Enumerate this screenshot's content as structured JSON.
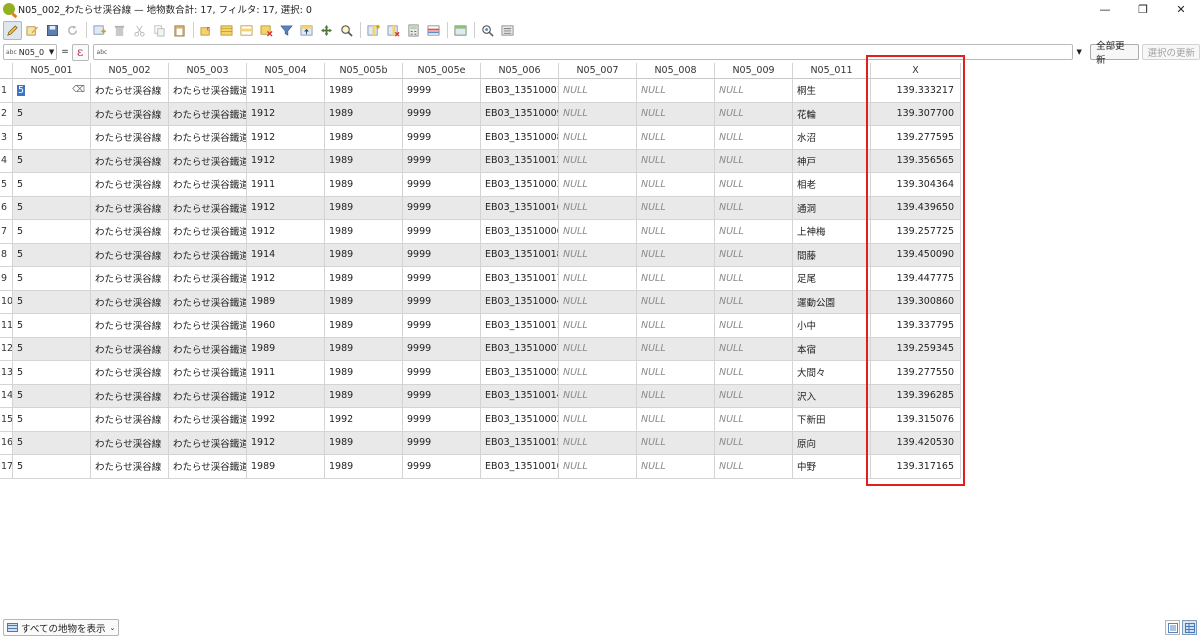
{
  "window": {
    "title": "N05_002_わたらせ渓谷線 — 地物数合計: 17, フィルタ: 17, 選択: 0",
    "minimize": "—",
    "restore": "❐",
    "close": "✕"
  },
  "toolbar": {
    "icons": [
      "edit-pencil-icon",
      "multi-edit-icon",
      "save-icon",
      "reload-icon",
      "add-feature-icon",
      "delete-icon",
      "cut-icon",
      "copy-icon",
      "paste-icon",
      "select-expression-icon",
      "select-all-icon",
      "invert-selection-icon",
      "deselect-icon",
      "filter-icon",
      "move-top-icon",
      "pan-to-icon",
      "zoom-to-icon",
      "new-field-icon",
      "delete-field-icon",
      "field-calculator-icon",
      "conditional-format-icon",
      "dock-icon",
      "actions-icon",
      "settings-icon"
    ]
  },
  "filter": {
    "field_type": "abc",
    "field_name": "N05_0",
    "equals": "=",
    "epsilon": "ε",
    "expression_type": "abc",
    "update_all": "全部更新",
    "update_selected": "選択の更新"
  },
  "table": {
    "columns": [
      "N05_001",
      "N05_002",
      "N05_003",
      "N05_004",
      "N05_005b",
      "N05_005e",
      "N05_006",
      "N05_007",
      "N05_008",
      "N05_009",
      "N05_011",
      "X"
    ],
    "rows": [
      {
        "n": "1",
        "c": [
          "5",
          "わたらせ渓谷線",
          "わたらせ渓谷鐵道",
          "1911",
          "1989",
          "9999",
          "EB03_13510001",
          "NULL",
          "NULL",
          "NULL",
          "桐生",
          "139.333217"
        ]
      },
      {
        "n": "2",
        "c": [
          "5",
          "わたらせ渓谷線",
          "わたらせ渓谷鐵道",
          "1912",
          "1989",
          "9999",
          "EB03_13510009",
          "NULL",
          "NULL",
          "NULL",
          "花輪",
          "139.307700"
        ]
      },
      {
        "n": "3",
        "c": [
          "5",
          "わたらせ渓谷線",
          "わたらせ渓谷鐵道",
          "1912",
          "1989",
          "9999",
          "EB03_13510008",
          "NULL",
          "NULL",
          "NULL",
          "水沼",
          "139.277595"
        ]
      },
      {
        "n": "4",
        "c": [
          "5",
          "わたらせ渓谷線",
          "わたらせ渓谷鐵道",
          "1912",
          "1989",
          "9999",
          "EB03_13510012",
          "NULL",
          "NULL",
          "NULL",
          "神戸",
          "139.356565"
        ]
      },
      {
        "n": "5",
        "c": [
          "5",
          "わたらせ渓谷線",
          "わたらせ渓谷鐵道",
          "1911",
          "1989",
          "9999",
          "EB03_13510003",
          "NULL",
          "NULL",
          "NULL",
          "相老",
          "139.304364"
        ]
      },
      {
        "n": "6",
        "c": [
          "5",
          "わたらせ渓谷線",
          "わたらせ渓谷鐵道",
          "1912",
          "1989",
          "9999",
          "EB03_13510016",
          "NULL",
          "NULL",
          "NULL",
          "通洞",
          "139.439650"
        ]
      },
      {
        "n": "7",
        "c": [
          "5",
          "わたらせ渓谷線",
          "わたらせ渓谷鐵道",
          "1912",
          "1989",
          "9999",
          "EB03_13510006",
          "NULL",
          "NULL",
          "NULL",
          "上神梅",
          "139.257725"
        ]
      },
      {
        "n": "8",
        "c": [
          "5",
          "わたらせ渓谷線",
          "わたらせ渓谷鐵道",
          "1914",
          "1989",
          "9999",
          "EB03_13510018",
          "NULL",
          "NULL",
          "NULL",
          "間藤",
          "139.450090"
        ]
      },
      {
        "n": "9",
        "c": [
          "5",
          "わたらせ渓谷線",
          "わたらせ渓谷鐵道",
          "1912",
          "1989",
          "9999",
          "EB03_13510017",
          "NULL",
          "NULL",
          "NULL",
          "足尾",
          "139.447775"
        ]
      },
      {
        "n": "10",
        "c": [
          "5",
          "わたらせ渓谷線",
          "わたらせ渓谷鐵道",
          "1989",
          "1989",
          "9999",
          "EB03_13510004",
          "NULL",
          "NULL",
          "NULL",
          "運動公園",
          "139.300860"
        ]
      },
      {
        "n": "11",
        "c": [
          "5",
          "わたらせ渓谷線",
          "わたらせ渓谷鐵道",
          "1960",
          "1989",
          "9999",
          "EB03_13510011",
          "NULL",
          "NULL",
          "NULL",
          "小中",
          "139.337795"
        ]
      },
      {
        "n": "12",
        "c": [
          "5",
          "わたらせ渓谷線",
          "わたらせ渓谷鐵道",
          "1989",
          "1989",
          "9999",
          "EB03_13510007",
          "NULL",
          "NULL",
          "NULL",
          "本宿",
          "139.259345"
        ]
      },
      {
        "n": "13",
        "c": [
          "5",
          "わたらせ渓谷線",
          "わたらせ渓谷鐵道",
          "1911",
          "1989",
          "9999",
          "EB03_13510005",
          "NULL",
          "NULL",
          "NULL",
          "大間々",
          "139.277550"
        ]
      },
      {
        "n": "14",
        "c": [
          "5",
          "わたらせ渓谷線",
          "わたらせ渓谷鐵道",
          "1912",
          "1989",
          "9999",
          "EB03_13510014",
          "NULL",
          "NULL",
          "NULL",
          "沢入",
          "139.396285"
        ]
      },
      {
        "n": "15",
        "c": [
          "5",
          "わたらせ渓谷線",
          "わたらせ渓谷鐵道",
          "1992",
          "1992",
          "9999",
          "EB03_13510002",
          "NULL",
          "NULL",
          "NULL",
          "下新田",
          "139.315076"
        ]
      },
      {
        "n": "16",
        "c": [
          "5",
          "わたらせ渓谷線",
          "わたらせ渓谷鐵道",
          "1912",
          "1989",
          "9999",
          "EB03_13510015",
          "NULL",
          "NULL",
          "NULL",
          "原向",
          "139.420530"
        ]
      },
      {
        "n": "17",
        "c": [
          "5",
          "わたらせ渓谷線",
          "わたらせ渓谷鐵道",
          "1989",
          "1989",
          "9999",
          "EB03_13510010",
          "NULL",
          "NULL",
          "NULL",
          "中野",
          "139.317165"
        ]
      }
    ]
  },
  "bottom": {
    "show_all_label": "すべての地物を表示",
    "dropdown_arrow": "⌄"
  },
  "colors": {
    "highlight_border": "#e02020",
    "row_alt": "#e9e9e9",
    "selection": "#3b74c4"
  }
}
